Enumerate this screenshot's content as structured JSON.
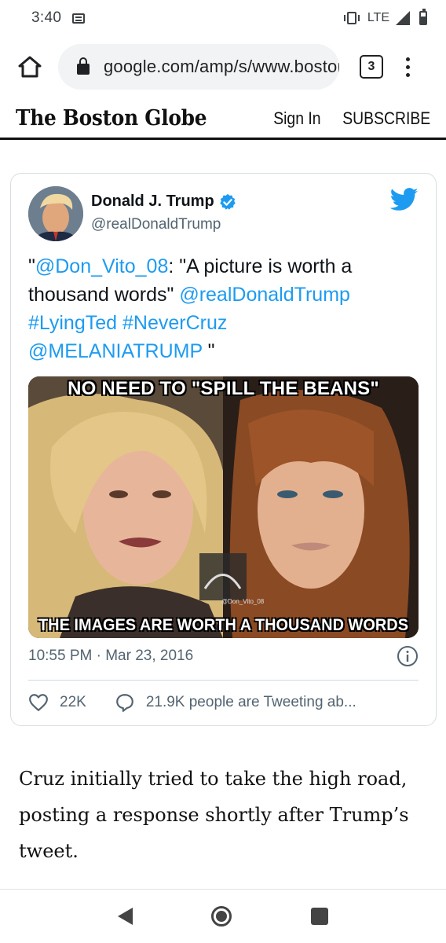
{
  "status_bar": {
    "time": "3:40",
    "network": "LTE",
    "icons": [
      "message-icon",
      "vibrate-icon",
      "signal-icon",
      "battery-icon"
    ]
  },
  "browser": {
    "url": "google.com/amp/s/www.bostonglobe.com",
    "tab_count": "3",
    "icons": [
      "home-icon",
      "lock-icon",
      "more-vert-icon"
    ]
  },
  "site_header": {
    "logo": "The Boston Globe",
    "sign_in": "Sign In",
    "subscribe": "SUBSCRIBE"
  },
  "tweet": {
    "author_name": "Donald J. Trump",
    "author_handle": "@realDonaldTrump",
    "text_parts": {
      "p1": "\"",
      "mention1": "@Don_Vito_08",
      "p2": ": \"A picture is worth a thousand words\" ",
      "mention2": "@realDonaldTrump",
      "p3": " ",
      "hashtag1": "#LyingTed",
      "p4": " ",
      "hashtag2": "#NeverCruz",
      "p5": " ",
      "mention3": "@MELANIATRUMP",
      "p6": " \""
    },
    "media": {
      "caption_top": "NO NEED TO \"SPILL THE BEANS\"",
      "caption_bottom": "THE IMAGES ARE WORTH A THOUSAND WORDS",
      "watermark": "@Don_Vito_08"
    },
    "timestamp": "10:55 PM · Mar 23, 2016",
    "like_count": "22K",
    "reply_text": "21.9K people are Tweeting ab...",
    "colors": {
      "link": "#1d9bf0",
      "verified": "#1d9bf0",
      "bird": "#1d9bf0"
    }
  },
  "article": {
    "paragraph": "Cruz initially tried to take the high road, posting a response shortly after Trump’s tweet."
  },
  "nav_bar": {
    "icons": [
      "back-icon",
      "home-circle-icon",
      "recents-icon"
    ]
  }
}
